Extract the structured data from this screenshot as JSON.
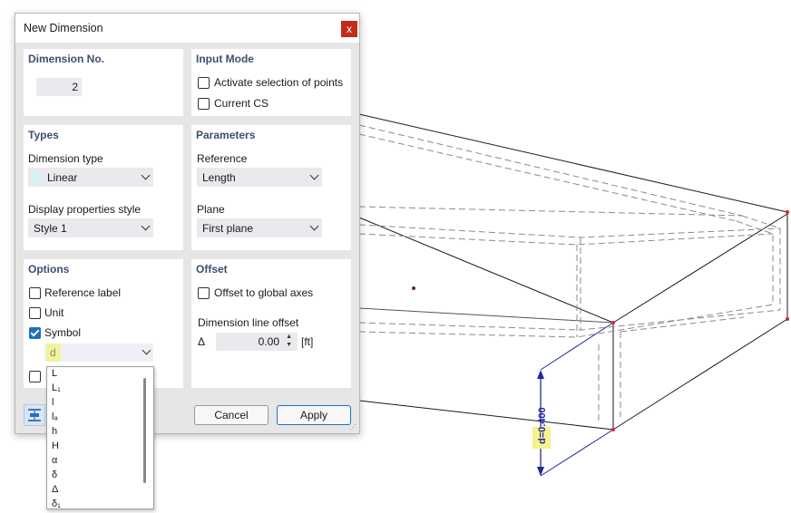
{
  "dialog": {
    "title": "New Dimension",
    "close_glyph": "x"
  },
  "dimension_no": {
    "title": "Dimension No.",
    "value": "2"
  },
  "input_mode": {
    "title": "Input Mode",
    "activate_selection_label": "Activate selection of points",
    "activate_selection_checked": false,
    "current_cs_label": "Current CS",
    "current_cs_checked": false
  },
  "types": {
    "title": "Types",
    "dimension_type_label": "Dimension type",
    "dimension_type_value": "Linear",
    "dimension_type_swatch": "#d6f3f8",
    "display_style_label": "Display properties style",
    "display_style_value": "Style 1"
  },
  "parameters": {
    "title": "Parameters",
    "reference_label": "Reference",
    "reference_value": "Length",
    "plane_label": "Plane",
    "plane_value": "First plane"
  },
  "options": {
    "title": "Options",
    "reference_label_text": "Reference label",
    "reference_label_checked": false,
    "unit_text": "Unit",
    "unit_checked": false,
    "symbol_text": "Symbol",
    "symbol_checked": true,
    "symbol_value": "d",
    "symbol_highlight": "#f2f29a"
  },
  "offset": {
    "title": "Offset",
    "global_axes_label": "Offset to global axes",
    "global_axes_checked": false,
    "line_offset_label": "Dimension line offset",
    "delta_symbol": "Δ",
    "value": "0.00",
    "unit": "[ft]"
  },
  "symbol_dropdown": {
    "items": [
      "L",
      "L₁",
      "l",
      "lₐ",
      "h",
      "H",
      "α",
      "δ",
      "Δ",
      "δ₁"
    ]
  },
  "buttons": {
    "cancel": "Cancel",
    "apply": "Apply"
  },
  "drawing": {
    "dimension_label": "d=0.400",
    "label_highlight": "#f7f28c",
    "dimension_color": "#1e2a9e",
    "node_color": "#e0202a"
  },
  "colors": {
    "accent": "#1f6fbf",
    "panel_title": "#3d4f6e",
    "close": "#c42b1c"
  }
}
